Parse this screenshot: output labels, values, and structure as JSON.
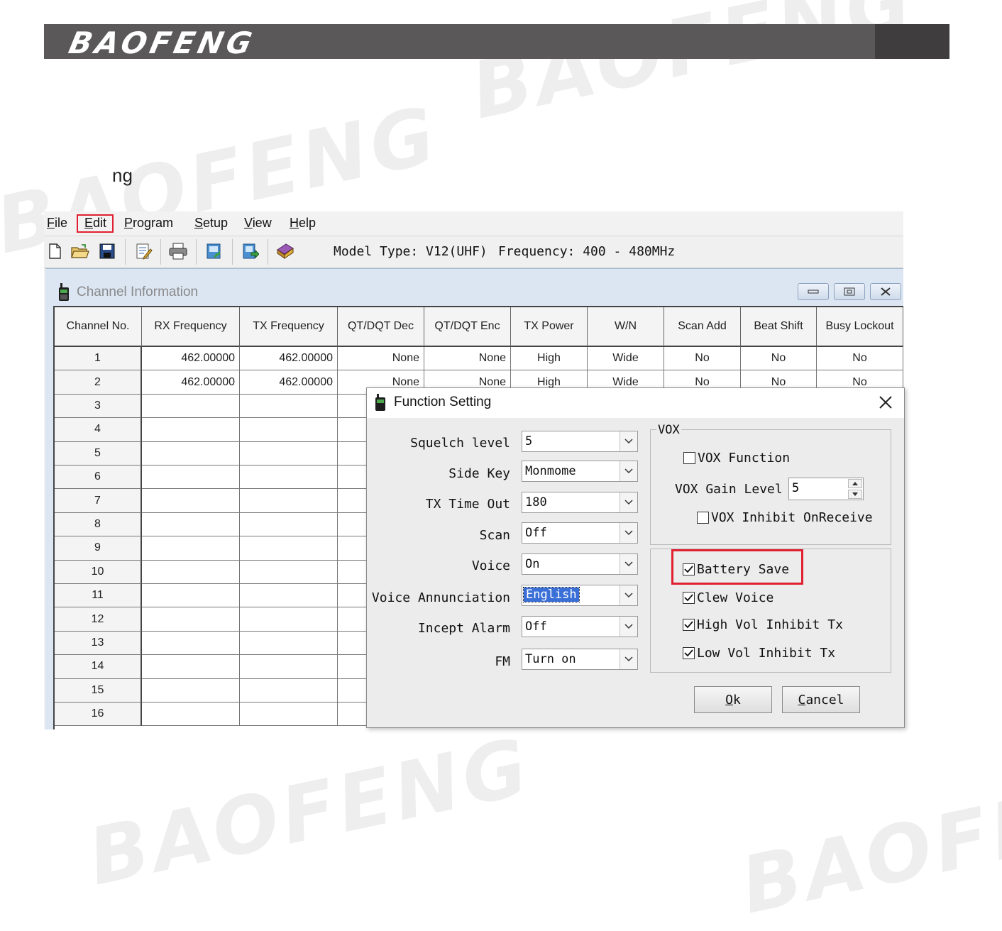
{
  "brand": {
    "logo_text": "BAOFENG"
  },
  "watermark": "BAOFENG",
  "fragment_text": "ng",
  "menu": {
    "items": [
      {
        "label": "File",
        "underline": "F",
        "rest": "ile"
      },
      {
        "label": "Edit",
        "underline": "E",
        "rest": "dit"
      },
      {
        "label": "Program",
        "underline": "P",
        "rest": "rogram"
      },
      {
        "label": "Setup",
        "underline": "S",
        "rest": "etup"
      },
      {
        "label": "View",
        "underline": "V",
        "rest": "iew"
      },
      {
        "label": "Help",
        "underline": "H",
        "rest": "elp"
      }
    ],
    "highlight_color": "#e02030"
  },
  "toolbar": {
    "model_type": "Model Type: V12(UHF)",
    "frequency": "Frequency: 400 - 480MHz"
  },
  "channel_window": {
    "title": "Channel Information",
    "columns": [
      "Channel No.",
      "RX Frequency",
      "TX Frequency",
      "QT/DQT Dec",
      "QT/DQT Enc",
      "TX Power",
      "W/N",
      "Scan Add",
      "Beat Shift",
      "Busy Lockout"
    ],
    "rows": [
      [
        "1",
        "462.00000",
        "462.00000",
        "None",
        "None",
        "High",
        "Wide",
        "No",
        "No",
        "No"
      ],
      [
        "2",
        "462.00000",
        "462.00000",
        "None",
        "None",
        "High",
        "Wide",
        "No",
        "No",
        "No"
      ],
      [
        "3",
        "",
        "",
        "",
        "",
        "",
        "",
        "",
        "",
        ""
      ],
      [
        "4",
        "",
        "",
        "",
        "",
        "",
        "",
        "",
        "",
        ""
      ],
      [
        "5",
        "",
        "",
        "",
        "",
        "",
        "",
        "",
        "",
        ""
      ],
      [
        "6",
        "",
        "",
        "",
        "",
        "",
        "",
        "",
        "",
        ""
      ],
      [
        "7",
        "",
        "",
        "",
        "",
        "",
        "",
        "",
        "",
        ""
      ],
      [
        "8",
        "",
        "",
        "",
        "",
        "",
        "",
        "",
        "",
        ""
      ],
      [
        "9",
        "",
        "",
        "",
        "",
        "",
        "",
        "",
        "",
        ""
      ],
      [
        "10",
        "",
        "",
        "",
        "",
        "",
        "",
        "",
        "",
        ""
      ],
      [
        "11",
        "",
        "",
        "",
        "",
        "",
        "",
        "",
        "",
        ""
      ],
      [
        "12",
        "",
        "",
        "",
        "",
        "",
        "",
        "",
        "",
        ""
      ],
      [
        "13",
        "",
        "",
        "",
        "",
        "",
        "",
        "",
        "",
        ""
      ],
      [
        "14",
        "",
        "",
        "",
        "",
        "",
        "",
        "",
        "",
        ""
      ],
      [
        "15",
        "",
        "",
        "",
        "",
        "",
        "",
        "",
        "",
        ""
      ],
      [
        "16",
        "",
        "",
        "",
        "",
        "",
        "",
        "",
        "",
        ""
      ]
    ]
  },
  "dialog": {
    "title": "Function Setting",
    "fields": [
      {
        "label": "Squelch level",
        "value": "5"
      },
      {
        "label": "Side Key",
        "value": "Monmome"
      },
      {
        "label": "TX Time Out",
        "value": "180"
      },
      {
        "label": "Scan",
        "value": "Off"
      },
      {
        "label": "Voice",
        "value": "On"
      },
      {
        "label": "Voice Annunciation",
        "value": "English",
        "selected": true
      },
      {
        "label": "Incept Alarm",
        "value": "Off"
      },
      {
        "label": "FM",
        "value": "Turn on"
      }
    ],
    "vox": {
      "legend": "VOX",
      "function_label": "VOX Function",
      "function_checked": false,
      "gain_label": "VOX Gain Level",
      "gain_value": "5",
      "inhibit_label": "VOX Inhibit OnReceive",
      "inhibit_checked": false
    },
    "options": [
      {
        "label": "Battery Save",
        "checked": true
      },
      {
        "label": "Clew Voice",
        "checked": true
      },
      {
        "label": "High Vol Inhibit Tx",
        "checked": true
      },
      {
        "label": "Low Vol Inhibit Tx",
        "checked": true
      }
    ],
    "ok_label": "Ok",
    "ok_underline": "O",
    "ok_rest": "k",
    "cancel_label": "Cancel",
    "cancel_underline": "C",
    "cancel_rest": "ancel"
  }
}
